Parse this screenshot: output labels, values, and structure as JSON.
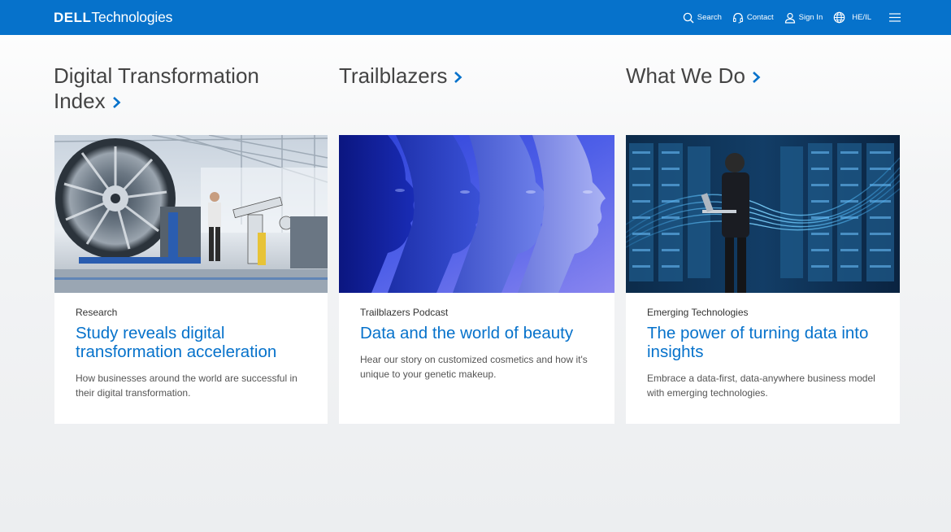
{
  "brand": {
    "logo_bold": "DELL",
    "logo_light": "Technologies"
  },
  "nav": {
    "search": "Search",
    "contact": "Contact",
    "sign_in": "Sign In",
    "region": "HE/IL"
  },
  "colors": {
    "header_bg": "#0672cb",
    "link_blue": "#0672cb"
  },
  "columns": [
    {
      "heading_line1": "Digital Transformation",
      "heading_line2": "Index",
      "category": "Research",
      "title": "Study reveals digital transformation acceleration",
      "description": "How businesses around the world are successful in their digital transformation.",
      "image": "jet-engine-factory-image"
    },
    {
      "heading_line1": "Trailblazers",
      "category": "Trailblazers Podcast",
      "title": "Data and the world of beauty",
      "description": "Hear our story on customized cosmetics and how it's unique to your genetic makeup.",
      "image": "faces-profile-image"
    },
    {
      "heading_line1": "What We Do",
      "category": "Emerging Technologies",
      "title": "The power of turning data into insights",
      "description": "Embrace a data-first, data-anywhere business model with emerging technologies.",
      "image": "datacenter-laptop-image"
    }
  ]
}
